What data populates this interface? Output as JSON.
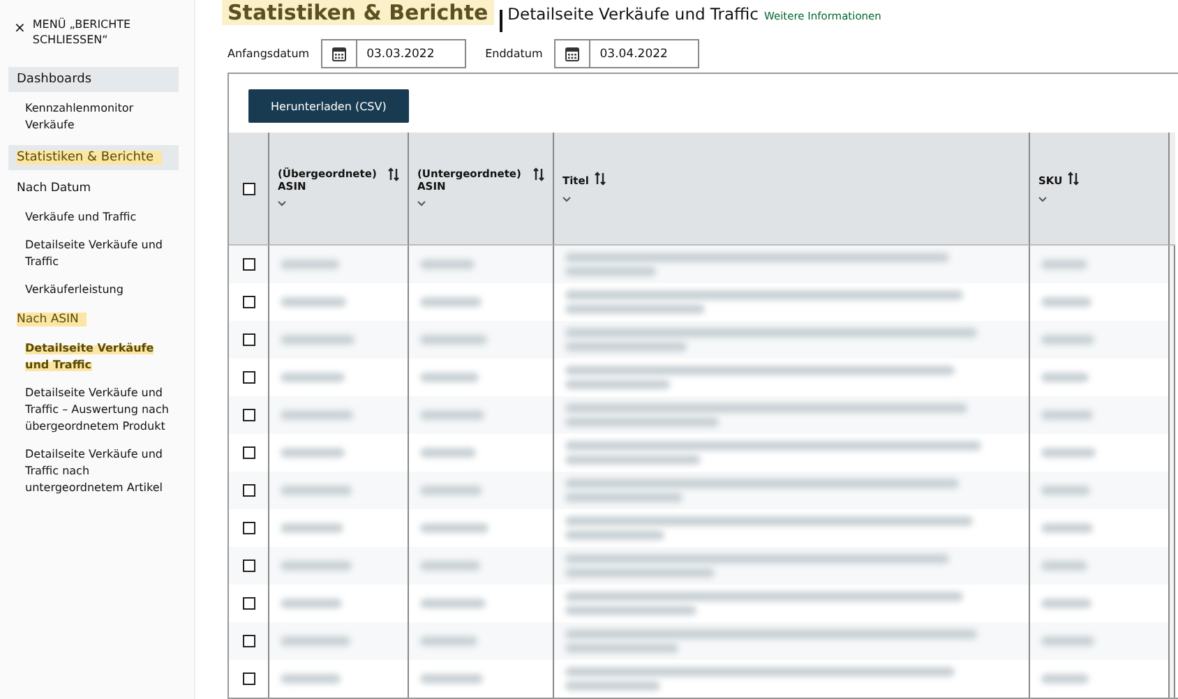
{
  "sidebar": {
    "close_icon": "×",
    "close_label": "MENÜ „BERICHTE SCHLIESSEN“",
    "items": [
      {
        "kind": "header",
        "label": "Dashboards",
        "highlighted": false
      },
      {
        "kind": "link",
        "label": "Kennzahlenmonitor Verkäufe",
        "selected": false
      },
      {
        "kind": "header",
        "label": "Statistiken & Berichte",
        "highlighted": true
      },
      {
        "kind": "subheader",
        "label": "Nach Datum",
        "highlighted": false
      },
      {
        "kind": "link",
        "label": "Verkäufe und Traffic",
        "selected": false
      },
      {
        "kind": "link",
        "label": "Detailseite Verkäufe und Traffic",
        "selected": false
      },
      {
        "kind": "link",
        "label": "Verkäuferleistung",
        "selected": false
      },
      {
        "kind": "subheader",
        "label": "Nach ASIN",
        "highlighted": true
      },
      {
        "kind": "link",
        "label": "Detailseite Verkäufe und Traffic",
        "selected": true
      },
      {
        "kind": "link",
        "label": "Detailseite Verkäufe und Traffic – Auswertung nach übergeordnetem Produkt",
        "selected": false
      },
      {
        "kind": "link",
        "label": "Detailseite Verkäufe und Traffic nach untergeordnetem Artikel",
        "selected": false
      }
    ]
  },
  "header": {
    "title": "Statistiken & Berichte",
    "subtitle": "Detailseite Verkäufe und Traffic",
    "link": "Weitere Informationen"
  },
  "filters": [
    {
      "label": "Anfangsdatum",
      "value": "03.03.2022"
    },
    {
      "label": "Enddatum",
      "value": "03.04.2022"
    }
  ],
  "table": {
    "download_button": "Herunterladen (CSV)",
    "select_all_checked": false,
    "columns": [
      "(Übergeordnete) ASIN",
      "(Untergeordnete) ASIN",
      "Titel",
      "SKU"
    ],
    "rows": [
      {
        "checked": false
      },
      {
        "checked": false
      },
      {
        "checked": false
      },
      {
        "checked": false
      },
      {
        "checked": false
      },
      {
        "checked": false
      },
      {
        "checked": false
      },
      {
        "checked": false
      },
      {
        "checked": false
      },
      {
        "checked": false
      },
      {
        "checked": false
      },
      {
        "checked": false
      }
    ]
  }
}
